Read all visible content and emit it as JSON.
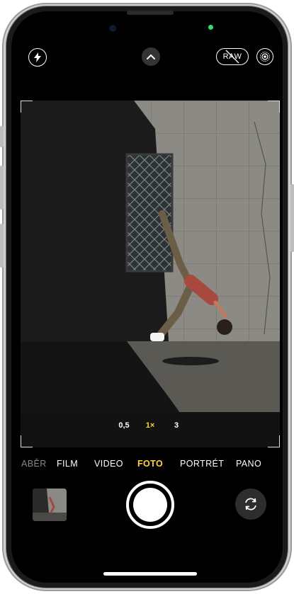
{
  "top_bar": {
    "flash_icon": "lightning-bolt-icon",
    "more_controls_icon": "chevron-up-icon",
    "raw_label": "RAW",
    "raw_disabled": true,
    "live_photo_icon": "live-photo-icon"
  },
  "zoom": {
    "options": [
      "0,5",
      "1×",
      "3"
    ],
    "active_index": 1
  },
  "modes": {
    "items": [
      "ABĚR",
      "FILM",
      "VIDEO",
      "FOTO",
      "PORTRÉT",
      "PANO"
    ],
    "active": "FOTO"
  },
  "colors": {
    "accent": "#ffd43b",
    "background": "#000000",
    "indicator_green": "#2be36a"
  },
  "bottom": {
    "thumbnail_icon": "last-photo-thumbnail",
    "shutter_icon": "shutter-button",
    "flip_icon": "camera-flip-icon"
  }
}
